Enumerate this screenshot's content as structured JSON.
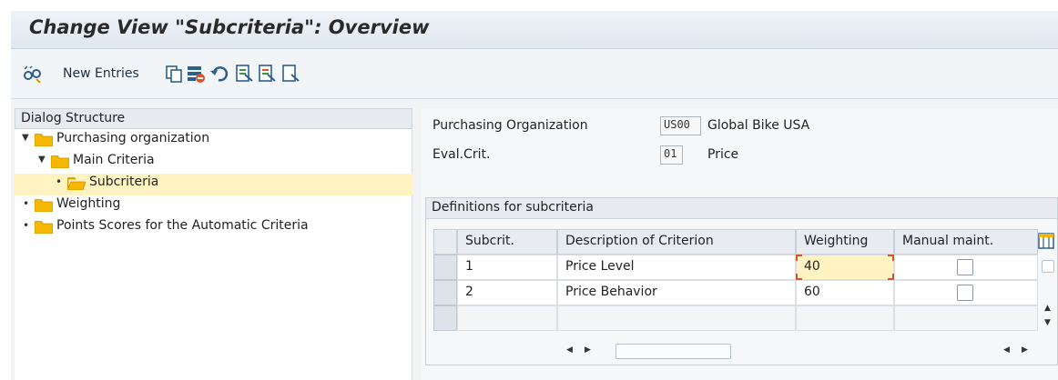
{
  "window": {
    "title": "Change View \"Subcriteria\": Overview"
  },
  "toolbar": {
    "new_entries_label": "New Entries"
  },
  "dialog_structure": {
    "header": "Dialog Structure",
    "nodes": [
      {
        "label": "Purchasing organization",
        "level": 0,
        "expanded": true,
        "selected": false
      },
      {
        "label": "Main Criteria",
        "level": 1,
        "expanded": true,
        "selected": false
      },
      {
        "label": "Subcriteria",
        "level": 2,
        "expanded": false,
        "selected": true
      },
      {
        "label": "Weighting",
        "level": 0,
        "expanded": false,
        "selected": false
      },
      {
        "label": "Points Scores for the Automatic Criteria",
        "level": 0,
        "expanded": false,
        "selected": false
      }
    ]
  },
  "header_fields": {
    "purch_org": {
      "label": "Purchasing Organization",
      "code": "US00",
      "text": "Global Bike USA"
    },
    "eval_crit": {
      "label": "Eval.Crit.",
      "code": "01",
      "text": "Price"
    }
  },
  "subcriteria_table": {
    "title": "Definitions for subcriteria",
    "columns": [
      "Subcrit.",
      "Description of Criterion",
      "Weighting",
      "Manual maint."
    ],
    "rows": [
      {
        "subcrit": "1",
        "description": "Price Level",
        "weighting": "40",
        "manual_maint": false
      },
      {
        "subcrit": "2",
        "description": "Price Behavior",
        "weighting": "60",
        "manual_maint": false
      },
      {
        "subcrit": "",
        "description": "",
        "weighting": "",
        "manual_maint": null
      }
    ]
  },
  "colors": {
    "folder": "#f5b700",
    "selection": "#fff3c2",
    "focus_bracket": "#d4562a"
  },
  "icons": [
    "glasses-icon",
    "copy-icon",
    "delete-icon",
    "undo-icon",
    "select-all-icon",
    "select-block-icon",
    "deselect-all-icon",
    "column-settings-icon"
  ]
}
